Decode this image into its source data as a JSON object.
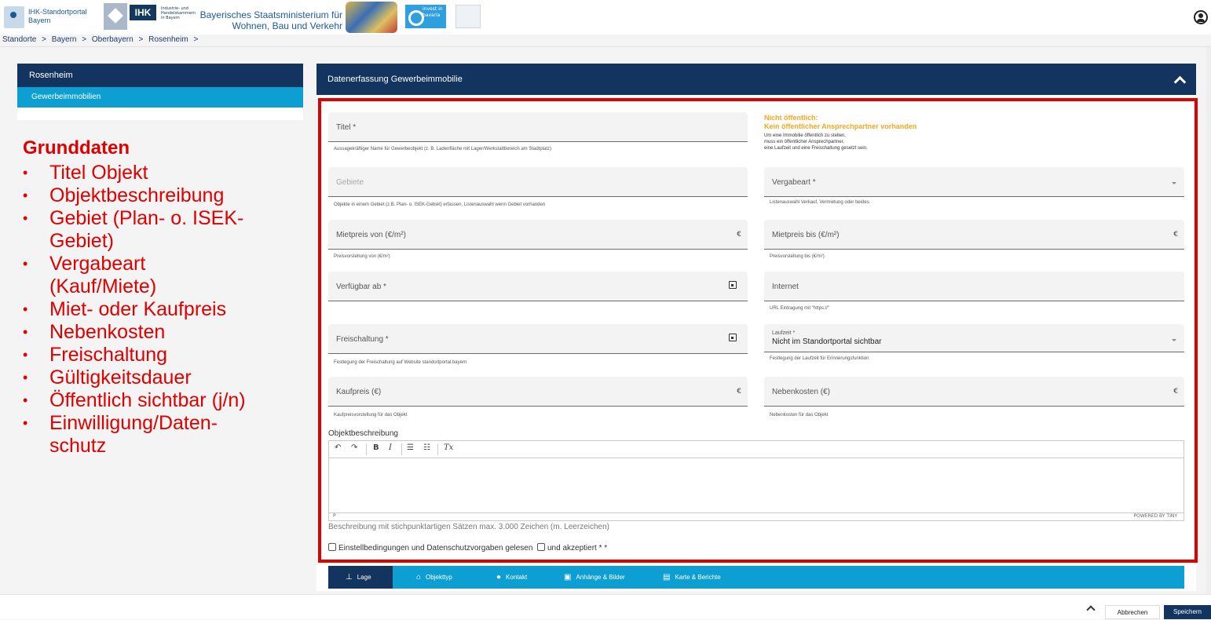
{
  "header": {
    "portal_name_line1": "IHK-Standortportal",
    "portal_name_line2": "Bayern",
    "ihk_logo": "IHK",
    "ihk_subtitle": "Industrie- und Handelskammern in Bayern",
    "ministry_line1": "Bayerisches Staatsministerium für",
    "ministry_line2": "Wohnen, Bau und Verkehr",
    "invest_text": "invest in bavaria",
    "user_icon": "user-circle-icon"
  },
  "breadcrumb": [
    "Standorte",
    ">",
    "Bayern",
    ">",
    "Oberbayern",
    ">",
    "Rosenheim",
    ">"
  ],
  "sidebar": {
    "title": "Rosenheim",
    "item": "Gewerbeimmobilien"
  },
  "annotation": {
    "heading": "Grunddaten",
    "items": [
      "Titel Objekt",
      "Objektbeschreibung",
      "Gebiet (Plan- o. ISEK-",
      "Gebiet)",
      "Vergabeart",
      "(Kauf/Miete)",
      "Miet- oder Kaufpreis",
      "Nebenkosten",
      "Freischaltung",
      "Gültigkeitsdauer",
      "Öffentlich sichtbar (j/n)",
      "Einwilligung/Daten-",
      "schutz"
    ]
  },
  "panel": {
    "title": "Datenerfassung Gewerbeimmobilie"
  },
  "form": {
    "titel": {
      "label": "Titel *",
      "hint": "Aussagekräftiger Name für Gewerbeobjekt (z. B. Ladenfläche mit Lager/Werkstattbereich am Stadtplatz)"
    },
    "note": {
      "title1": "Nicht öffentlich:",
      "title2": "Kein öffentlicher Ansprechpartner vorhanden",
      "text1": "Um eine Immobilie öffentlich zu stellen,",
      "text2": "muss ein öffentlicher Ansprechpartner,",
      "text3": "eine Laufzeit und eine Freischaltung gesetzt sein."
    },
    "gebiete": {
      "label": "Gebiete",
      "hint": "Objekte in einem Gebiet (z.B. Plan- o. ISEK-Gebiet) erfassen, Listenauswahl wenn Gebiet vorhanden"
    },
    "vergabeart": {
      "label": "Vergabeart *",
      "hint": "Listenauswahl Verkauf, Vermietung oder beides"
    },
    "mietpreis_von": {
      "label": "Mietpreis von (€/m²)",
      "suffix": "€",
      "hint": "Preisvorstellung von (€/m²)"
    },
    "mietpreis_bis": {
      "label": "Mietpreis bis (€/m²)",
      "suffix": "€",
      "hint": "Preisvorstellung bis (€/m²)"
    },
    "verfuegbar": {
      "label": "Verfügbar ab *"
    },
    "internet": {
      "label": "Internet",
      "hint": "URL Eintragung mit \"https://\""
    },
    "freischaltung": {
      "label": "Freischaltung *",
      "hint": "Festlegung der Freischaltung auf Website standortportal.bayern"
    },
    "laufzeit": {
      "label": "Laufzeit *",
      "value": "Nicht im Standortportal sichtbar",
      "hint": "Festlegung der Laufzeit für Erinnerungsfunktion"
    },
    "kaufpreis": {
      "label": "Kaufpreis (€)",
      "suffix": "€",
      "hint": "Kaufpreisvorstellung für das Objekt"
    },
    "nebenkosten": {
      "label": "Nebenkosten (€)",
      "suffix": "€",
      "hint": "Nebenkosten für das Objekt"
    },
    "objektbeschreibung": {
      "label": "Objektbeschreibung",
      "status_p": "P",
      "powered": "POWERED BY TINY",
      "hint": "Beschreibung mit stichpunktartigen Sätzen max. 3.000 Zeichen (m. Leerzeichen)"
    },
    "consent": {
      "part1": "Einstellbedingungen und Datenschutzvorgaben gelesen",
      "part2": "und akzeptiert * *"
    }
  },
  "tabs": [
    "Lage",
    "Objekttyp",
    "Kontakt",
    "Anhänge & Bilder",
    "Karte & Berichte"
  ],
  "footer": {
    "cancel": "Abbrechen",
    "save": "Speichern"
  },
  "colors": {
    "navy": "#12345e",
    "accent_blue": "#0e9fd2",
    "highlight_red": "#e00000",
    "warning_orange": "#f5a623"
  }
}
